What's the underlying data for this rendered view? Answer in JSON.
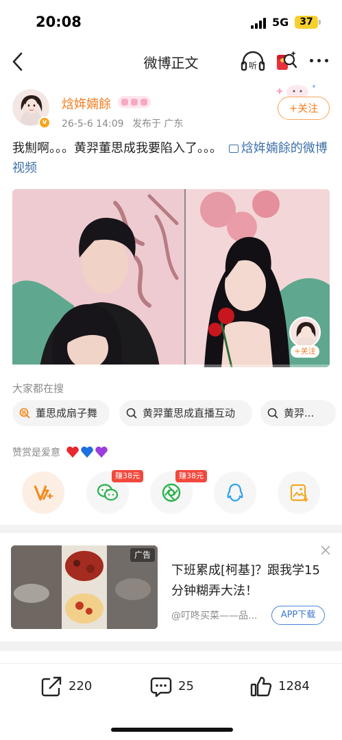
{
  "status_bar": {
    "time": "20:08",
    "network": "5G",
    "battery": "37"
  },
  "nav": {
    "title": "微博正文",
    "back_icon": "chevron-left-icon",
    "listen_label": "听",
    "icons": [
      "back-icon",
      "listen-icon",
      "red-packet-search-icon",
      "more-icon"
    ]
  },
  "post": {
    "author": "焓姩婻餘",
    "date": "26-5-6 14:09",
    "location": "发布于 广东",
    "follow_label": "+关注",
    "text": "我劁啊。。。黄羿董思成我要陷入了。。。",
    "video_link": "焓姩婻餘的微博视频",
    "video_progress": 0.6
  },
  "video": {
    "float_follow_label": "+关注"
  },
  "search": {
    "title": "大家都在搜",
    "chips": [
      "董思成扇子舞",
      "黄羿董思成直播互动",
      "黄羿..."
    ]
  },
  "reward": {
    "label": "赞赏是爱意",
    "hearts": [
      "#e8282f",
      "#1e6fe0",
      "#9b3ddc"
    ]
  },
  "share": {
    "items": [
      {
        "name": "vplus",
        "badge": ""
      },
      {
        "name": "wechat",
        "badge": "赚38元"
      },
      {
        "name": "moments",
        "badge": "赚38元"
      },
      {
        "name": "qq",
        "badge": ""
      },
      {
        "name": "save-image",
        "badge": ""
      }
    ]
  },
  "ad": {
    "tag": "广告",
    "title": "下班累成[柯基]？跟我学15分钟糊弄大法！",
    "source": "@叮咚买菜——品...",
    "button": "APP下载"
  },
  "actions": {
    "repost": "220",
    "comment": "25",
    "like": "1284"
  },
  "colors": {
    "accent_orange": "#f57c1f",
    "link_blue": "#3d6fa8",
    "badge_red": "#f2483c"
  }
}
